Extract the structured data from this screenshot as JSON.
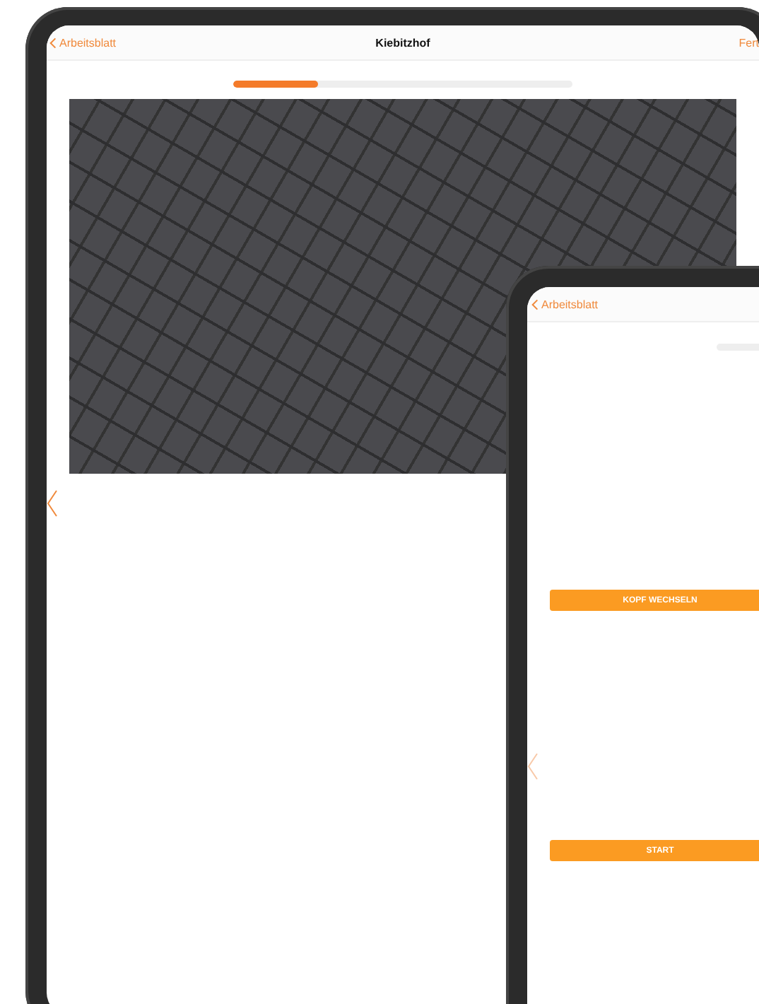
{
  "main_tablet": {
    "nav": {
      "back": "Arbeitsblatt",
      "title": "Kiebitzhof",
      "action": "Fert"
    },
    "progress": {
      "level": 0.25
    }
  },
  "second_tablet": {
    "nav": {
      "back": "Arbeitsblatt"
    },
    "buttons": [
      "KOPF WECHSELN",
      "START"
    ]
  }
}
